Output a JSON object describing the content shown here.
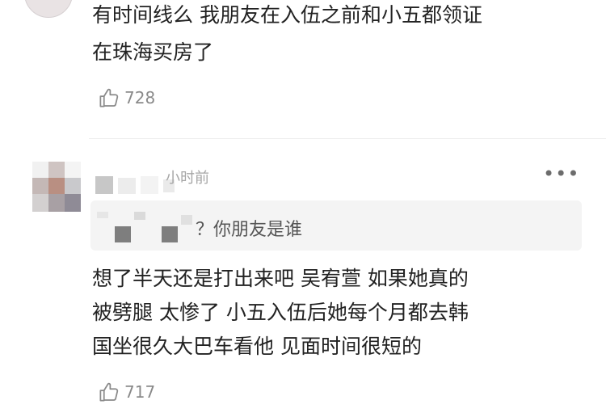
{
  "comment1": {
    "line1": "有时间线么 我朋友在入伍之前和小五都领证",
    "line2": "在珠海买房了",
    "likes": "728"
  },
  "comment2": {
    "time": "小时前",
    "more_label": "•••",
    "quote_text": "？你朋友是谁",
    "line1": "想了半天还是打出来吧 吴宥萱  如果她真的",
    "line2": "被劈腿 太惨了  小五入伍后她每个月都去韩",
    "line3": "国坐很久大巴车看他 见面时间很短的",
    "likes": "717"
  },
  "icons": {
    "like": "thumbs-up-icon",
    "more": "more-dots-icon"
  }
}
